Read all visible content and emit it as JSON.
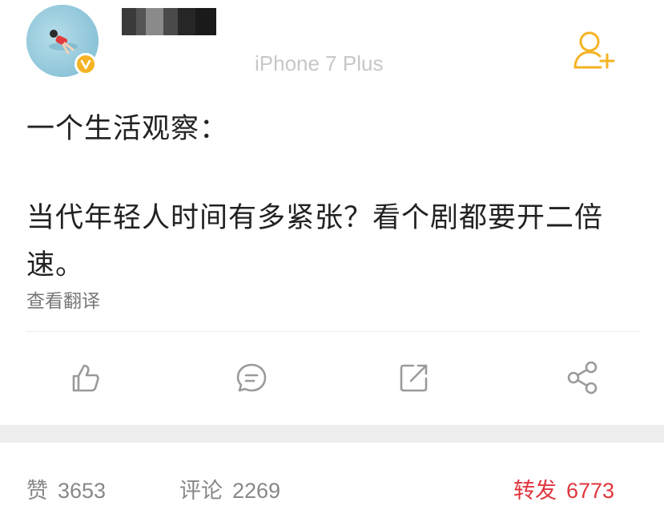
{
  "post": {
    "source": "iPhone 7 Plus",
    "text_lines": [
      "一个生活观察：",
      "当代年轻人时间有多紧张？看个剧都要开二倍",
      "速。"
    ],
    "translate_label": "查看翻译"
  },
  "icons": {
    "avatar": "avatar",
    "verified": "verified-badge-icon",
    "follow": "add-user-icon",
    "like": "thumb-up-icon",
    "comment": "comment-bubble-icon",
    "forward": "external-forward-icon",
    "share": "share-nodes-icon"
  },
  "stats": {
    "likes_label": "赞",
    "likes_count": "3653",
    "comments_label": "评论",
    "comments_count": "2269",
    "reposts_label": "转发",
    "reposts_count": "6773"
  },
  "colors": {
    "accent_yellow": "#f5b323",
    "active_red": "#e0353d",
    "icon_gray": "#9a9a9a"
  }
}
